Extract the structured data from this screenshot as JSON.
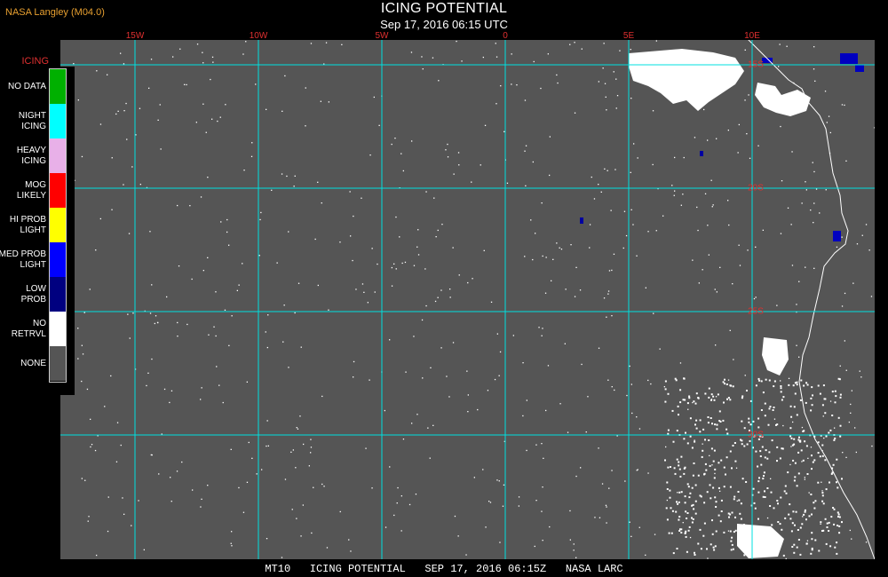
{
  "header": {
    "org": "NASA Langley (M04.0)",
    "title": "ICING POTENTIAL",
    "subtitle": "Sep 17, 2016 06:15 UTC"
  },
  "legend": {
    "title": "ICING",
    "items": [
      {
        "label": "NO DATA",
        "color": "#00b000"
      },
      {
        "label": "NIGHT\nICING",
        "color": "#00ffff"
      },
      {
        "label": "HEAVY\nICING",
        "color": "#e8b0e8"
      },
      {
        "label": "MOG\nLIKELY",
        "color": "#ff0000"
      },
      {
        "label": "HI PROB\nLIGHT",
        "color": "#ffff00"
      },
      {
        "label": "MED PROB\nLIGHT",
        "color": "#0000ff"
      },
      {
        "label": "LOW\nPROB",
        "color": "#000080"
      },
      {
        "label": "NO\nRETRVL",
        "color": "#ffffff"
      },
      {
        "label": "NONE",
        "color": "#555555"
      }
    ]
  },
  "map": {
    "background_color": "#555555",
    "grid_color": "#00e0e0",
    "lon_labels": [
      "15W",
      "10W",
      "5W",
      "0",
      "5E",
      "10E"
    ],
    "lat_labels": [
      "15S",
      "20S",
      "25S",
      "30S"
    ]
  },
  "footer": "MT10   ICING POTENTIAL   SEP 17, 2016 06:15Z   NASA LARC"
}
